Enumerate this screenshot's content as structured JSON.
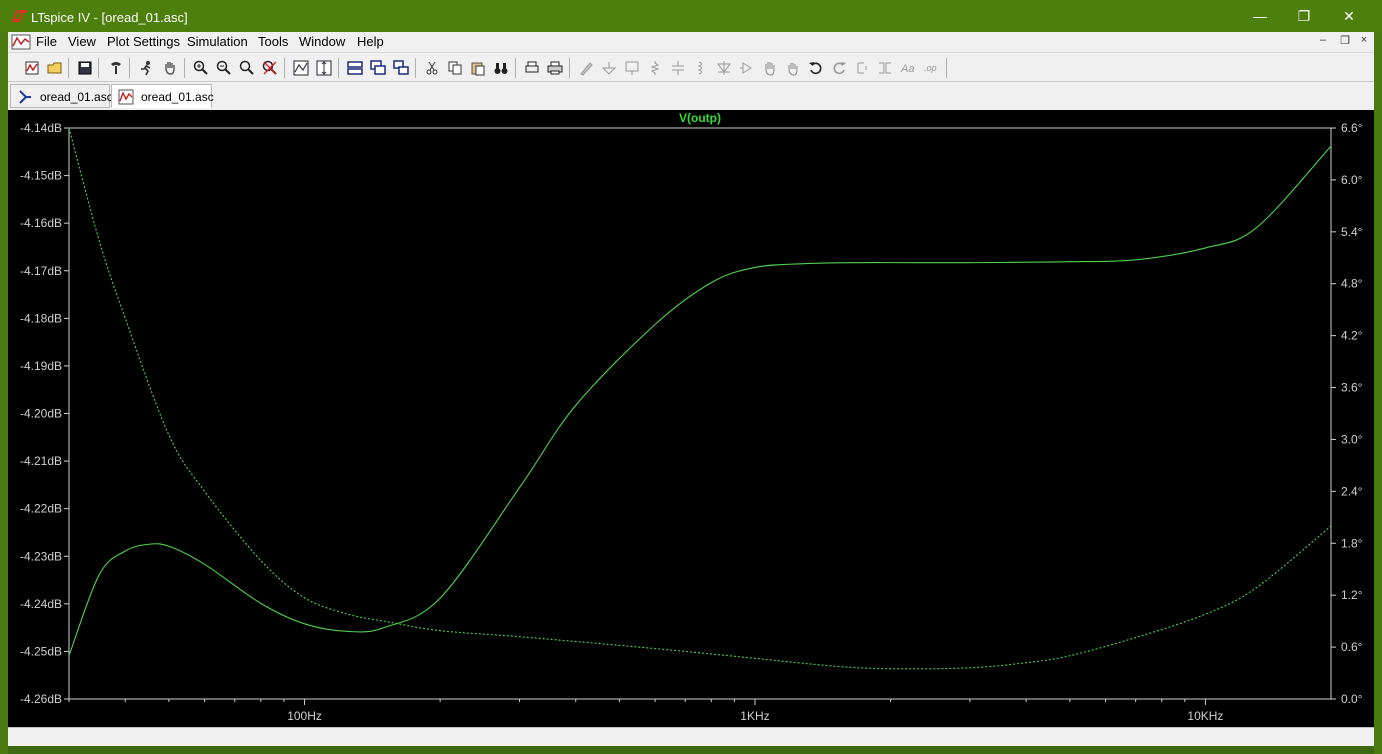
{
  "window": {
    "title": "LTspice IV - [oread_01.asc]",
    "controls": {
      "minimize": "—",
      "restore": "❐",
      "close": "✕"
    }
  },
  "menu": {
    "items": [
      "File",
      "View",
      "Plot Settings",
      "Simulation",
      "Tools",
      "Window",
      "Help"
    ],
    "mdi": {
      "minimize": "–",
      "restore": "❐",
      "close": "×"
    }
  },
  "toolbar": {
    "icons": [
      "new-schematic",
      "open",
      "save",
      "control-panel",
      "run",
      "pan",
      "zoom-in",
      "zoom-out",
      "zoom-fit",
      "zoom-cancel",
      "autoscale",
      "autoscale-y",
      "tile-horizontal",
      "cascade",
      "tile-vertical",
      "cut",
      "copy",
      "paste",
      "find",
      "print-preview",
      "print",
      "draw-wire",
      "ground",
      "label-net",
      "resistor",
      "capacitor",
      "inductor",
      "diode",
      "component",
      "move",
      "drag",
      "undo",
      "redo",
      "rotate",
      "mirror",
      "text",
      "spice-directive"
    ]
  },
  "tabs": [
    {
      "label": "oread_01.asc",
      "type": "schematic",
      "active": false
    },
    {
      "label": "oread_01.asc",
      "type": "waveform",
      "active": true
    }
  ],
  "colors": {
    "trace": "#4fd14f",
    "title": "#33dd33",
    "axis": "#d0d0d0",
    "titlebar": "#4d7f0d"
  },
  "chart_data": {
    "type": "line",
    "title": "V(outp)",
    "xscale": "log",
    "x_tick_labels": [
      "100Hz",
      "1KHz",
      "10KHz"
    ],
    "xlim": [
      30,
      19000
    ],
    "ylim_left": [
      -4.26,
      -4.14
    ],
    "ylim_right": [
      0.0,
      6.6
    ],
    "y_left_tick_labels": [
      "-4.14dB",
      "-4.15dB",
      "-4.16dB",
      "-4.17dB",
      "-4.18dB",
      "-4.19dB",
      "-4.20dB",
      "-4.21dB",
      "-4.22dB",
      "-4.23dB",
      "-4.24dB",
      "-4.25dB",
      "-4.26dB"
    ],
    "y_right_tick_labels": [
      "6.6°",
      "6.0°",
      "5.4°",
      "4.8°",
      "4.2°",
      "3.6°",
      "3.0°",
      "2.4°",
      "1.8°",
      "1.2°",
      "0.6°",
      "0.0°"
    ],
    "series": [
      {
        "name": "magnitude",
        "axis": "left",
        "style": "solid",
        "x": [
          30,
          35,
          40,
          45,
          50,
          60,
          80,
          100,
          125,
          150,
          200,
          300,
          400,
          600,
          800,
          1000,
          1300,
          1700,
          2200,
          3000,
          4000,
          5000,
          7000,
          10000,
          13000,
          19000
        ],
        "y": [
          -4.2509,
          -4.2339,
          -4.2289,
          -4.2275,
          -4.2279,
          -4.2317,
          -4.2399,
          -4.2442,
          -4.2458,
          -4.245,
          -4.2388,
          -4.2156,
          -4.1983,
          -4.1813,
          -4.1725,
          -4.1693,
          -4.1685,
          -4.1683,
          -4.1683,
          -4.1683,
          -4.1682,
          -4.1681,
          -4.1677,
          -4.1652,
          -4.1609,
          -4.1438
        ]
      },
      {
        "name": "phase",
        "axis": "right",
        "style": "dashed",
        "x": [
          30,
          35,
          40,
          50,
          60,
          80,
          100,
          125,
          150,
          200,
          300,
          500,
          700,
          1000,
          1500,
          2000,
          3000,
          4000,
          5000,
          7000,
          10000,
          13000,
          19000
        ],
        "y": [
          6.6,
          5.3,
          4.4,
          3.05,
          2.4,
          1.6,
          1.17,
          0.98,
          0.9,
          0.79,
          0.72,
          0.62,
          0.55,
          0.47,
          0.38,
          0.35,
          0.36,
          0.42,
          0.5,
          0.71,
          0.98,
          1.29,
          2.0
        ]
      }
    ]
  }
}
